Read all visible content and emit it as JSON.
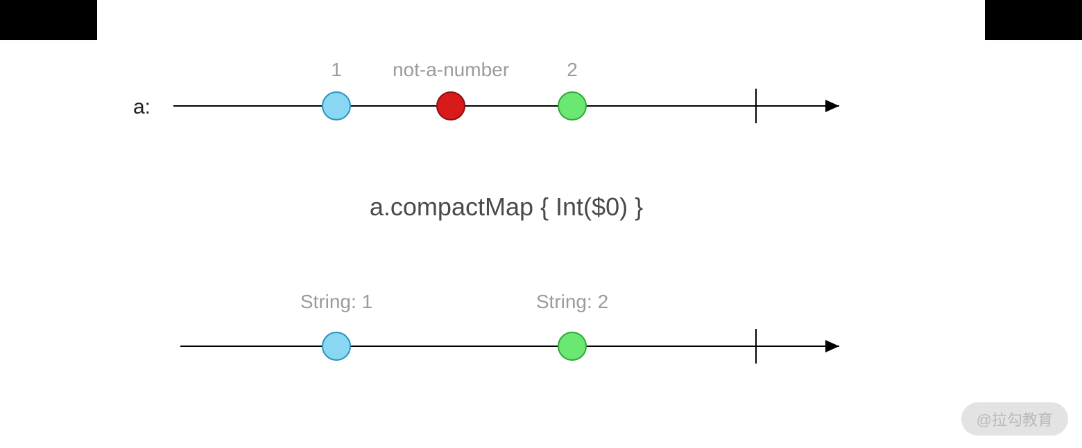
{
  "streamA": {
    "label": "a:",
    "marbles": [
      {
        "label": "1",
        "color": "#8ad7f3",
        "stroke": "#2a94bc"
      },
      {
        "label": "not-a-number",
        "color": "#d91a1a",
        "stroke": "#8a0f0f"
      },
      {
        "label": "2",
        "color": "#6be872",
        "stroke": "#2fa738"
      }
    ]
  },
  "operator": {
    "text": "a.compactMap { Int($0) }"
  },
  "streamB": {
    "marbles": [
      {
        "label": "String: 1",
        "color": "#8ad7f3",
        "stroke": "#2a94bc"
      },
      {
        "label": "String: 2",
        "color": "#6be872",
        "stroke": "#2fa738"
      }
    ]
  },
  "watermark": "@拉勾教育",
  "chart_data": {
    "type": "marble-diagram",
    "input_stream": {
      "name": "a",
      "events": [
        {
          "value": "1",
          "position": 1
        },
        {
          "value": "not-a-number",
          "position": 2
        },
        {
          "value": "2",
          "position": 3
        }
      ],
      "completes": true
    },
    "operator": "a.compactMap { Int($0) }",
    "output_stream": {
      "events": [
        {
          "value": "String: 1",
          "position": 1
        },
        {
          "value": "String: 2",
          "position": 3
        }
      ],
      "completes": true
    }
  }
}
